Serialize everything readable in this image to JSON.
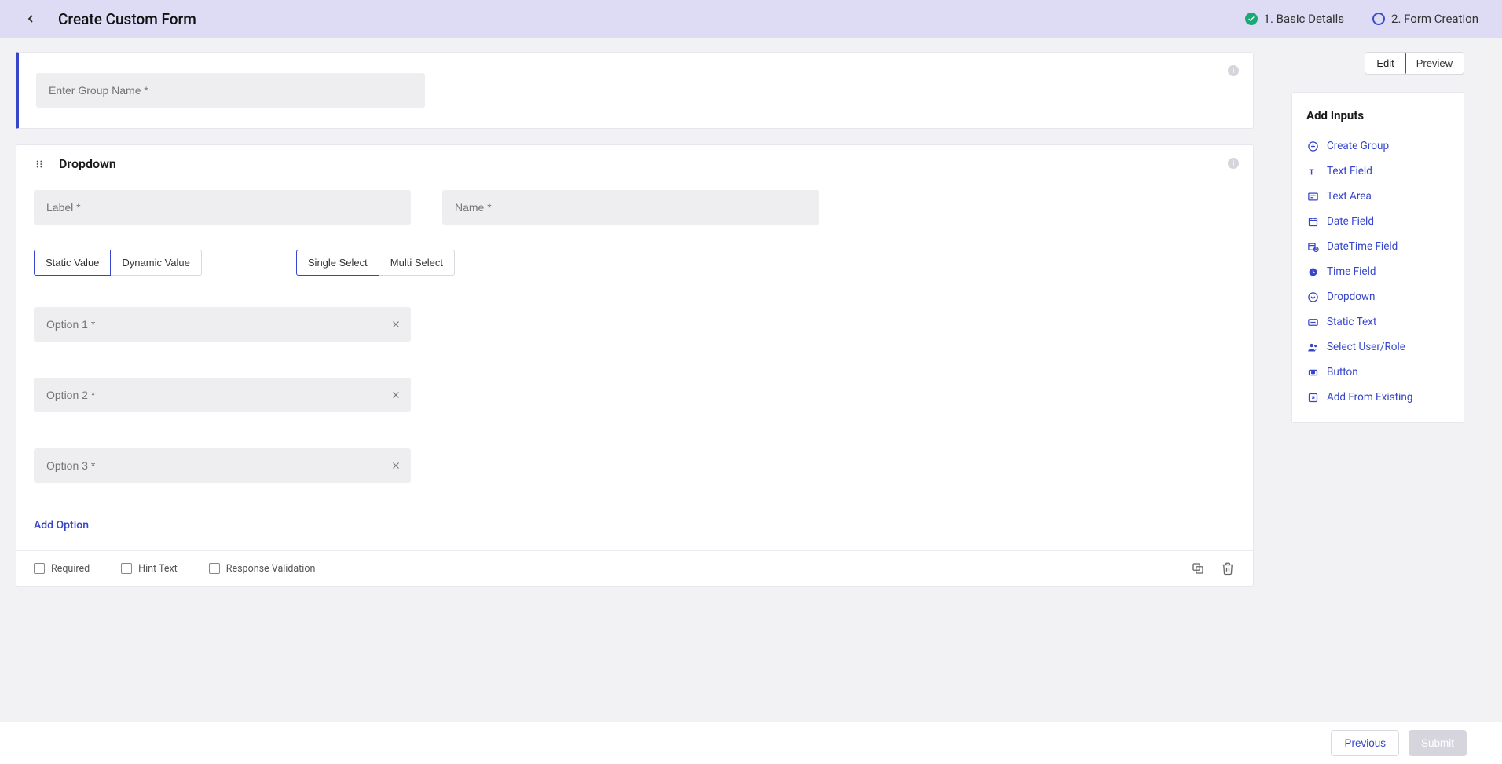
{
  "header": {
    "title": "Create Custom Form",
    "steps": [
      {
        "label": "1. Basic Details",
        "state": "done"
      },
      {
        "label": "2. Form Creation",
        "state": "pending"
      }
    ]
  },
  "toggle": {
    "edit": "Edit",
    "preview": "Preview"
  },
  "group": {
    "name_placeholder": "Enter Group Name *"
  },
  "dropdown": {
    "title": "Dropdown",
    "label_placeholder": "Label *",
    "name_placeholder": "Name *",
    "value_type": {
      "static": "Static Value",
      "dynamic": "Dynamic Value"
    },
    "select_type": {
      "single": "Single Select",
      "multi": "Multi Select"
    },
    "options": [
      {
        "placeholder": "Option 1 *"
      },
      {
        "placeholder": "Option 2 *"
      },
      {
        "placeholder": "Option 3 *"
      }
    ],
    "add_option": "Add Option",
    "checks": {
      "required": "Required",
      "hint": "Hint Text",
      "validation": "Response Validation"
    }
  },
  "sidebar": {
    "heading": "Add Inputs",
    "items": [
      {
        "icon": "plus-circle-icon",
        "label": "Create Group"
      },
      {
        "icon": "text-icon",
        "label": "Text Field"
      },
      {
        "icon": "textarea-icon",
        "label": "Text Area"
      },
      {
        "icon": "date-icon",
        "label": "Date Field"
      },
      {
        "icon": "datetime-icon",
        "label": "DateTime Field"
      },
      {
        "icon": "time-icon",
        "label": "Time Field"
      },
      {
        "icon": "dropdown-icon",
        "label": "Dropdown"
      },
      {
        "icon": "static-text-icon",
        "label": "Static Text"
      },
      {
        "icon": "user-role-icon",
        "label": "Select User/Role"
      },
      {
        "icon": "button-icon",
        "label": "Button"
      },
      {
        "icon": "add-existing-icon",
        "label": "Add From Existing"
      }
    ]
  },
  "footer": {
    "previous": "Previous",
    "submit": "Submit"
  }
}
